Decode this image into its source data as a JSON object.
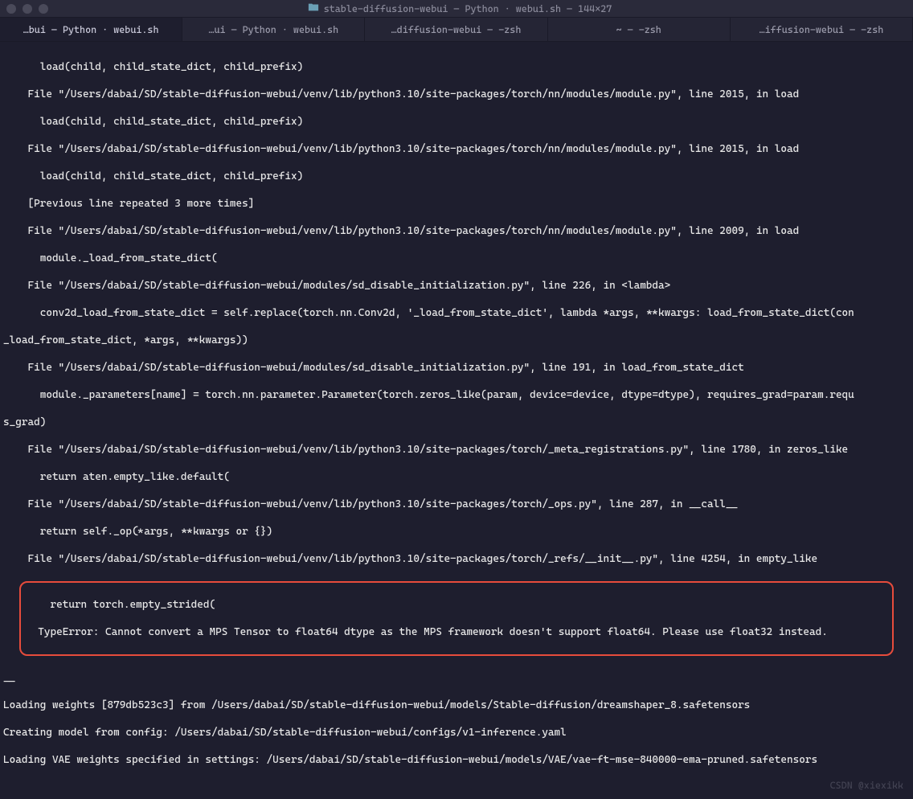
{
  "titlebar": {
    "title": "stable-diffusion-webui — Python · webui.sh — 144×27"
  },
  "tabs": [
    {
      "label": "…bui — Python · webui.sh",
      "active": true
    },
    {
      "label": "…ui — Python · webui.sh",
      "active": false
    },
    {
      "label": "…diffusion-webui — -zsh",
      "active": false
    },
    {
      "label": "~ — -zsh",
      "active": false
    },
    {
      "label": "…iffusion-webui — -zsh",
      "active": false
    }
  ],
  "terminal": {
    "lines": [
      "      load(child, child_state_dict, child_prefix)",
      "    File \"/Users/dabai/SD/stable-diffusion-webui/venv/lib/python3.10/site-packages/torch/nn/modules/module.py\", line 2015, in load",
      "      load(child, child_state_dict, child_prefix)",
      "    File \"/Users/dabai/SD/stable-diffusion-webui/venv/lib/python3.10/site-packages/torch/nn/modules/module.py\", line 2015, in load",
      "      load(child, child_state_dict, child_prefix)",
      "    [Previous line repeated 3 more times]",
      "    File \"/Users/dabai/SD/stable-diffusion-webui/venv/lib/python3.10/site-packages/torch/nn/modules/module.py\", line 2009, in load",
      "      module._load_from_state_dict(",
      "    File \"/Users/dabai/SD/stable-diffusion-webui/modules/sd_disable_initialization.py\", line 226, in <lambda>",
      "      conv2d_load_from_state_dict = self.replace(torch.nn.Conv2d, '_load_from_state_dict', lambda *args, **kwargs: load_from_state_dict(con",
      "_load_from_state_dict, *args, **kwargs))",
      "    File \"/Users/dabai/SD/stable-diffusion-webui/modules/sd_disable_initialization.py\", line 191, in load_from_state_dict",
      "      module._parameters[name] = torch.nn.parameter.Parameter(torch.zeros_like(param, device=device, dtype=dtype), requires_grad=param.requ",
      "s_grad)",
      "    File \"/Users/dabai/SD/stable-diffusion-webui/venv/lib/python3.10/site-packages/torch/_meta_registrations.py\", line 1780, in zeros_like",
      "      return aten.empty_like.default(",
      "    File \"/Users/dabai/SD/stable-diffusion-webui/venv/lib/python3.10/site-packages/torch/_ops.py\", line 287, in __call__",
      "      return self._op(*args, **kwargs or {})",
      "    File \"/Users/dabai/SD/stable-diffusion-webui/venv/lib/python3.10/site-packages/torch/_refs/__init__.py\", line 4254, in empty_like"
    ],
    "error_lines": [
      "    return torch.empty_strided(",
      "  TypeError: Cannot convert a MPS Tensor to float64 dtype as the MPS framework doesn't support float64. Please use float32 instead."
    ],
    "blank": "__",
    "post_lines": [
      "Loading weights [879db523c3] from /Users/dabai/SD/stable-diffusion-webui/models/Stable-diffusion/dreamshaper_8.safetensors",
      "Creating model from config: /Users/dabai/SD/stable-diffusion-webui/configs/v1-inference.yaml",
      "Loading VAE weights specified in settings: /Users/dabai/SD/stable-diffusion-webui/models/VAE/vae-ft-mse-840000-ema-pruned.safetensors"
    ]
  },
  "watermark": "CSDN @xiexikk"
}
